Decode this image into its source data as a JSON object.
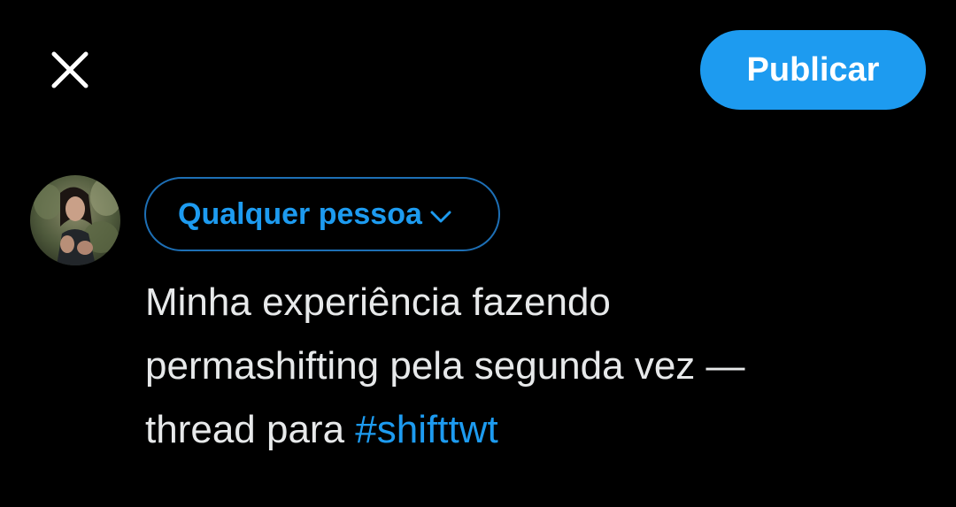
{
  "header": {
    "close_icon": "close-icon",
    "publish_label": "Publicar"
  },
  "composer": {
    "avatar_icon": "user-avatar",
    "audience_label": "Qualquer pessoa",
    "audience_chevron_icon": "chevron-down-icon",
    "text_lines": [
      "Minha experiência fazendo",
      "permashifting pela segunda vez —",
      "thread para "
    ],
    "hashtag": "#shifttwt"
  },
  "colors": {
    "background": "#000000",
    "accent": "#1d9bf0",
    "text": "#e7e9ea",
    "audience_border": "#1d6fb5"
  }
}
